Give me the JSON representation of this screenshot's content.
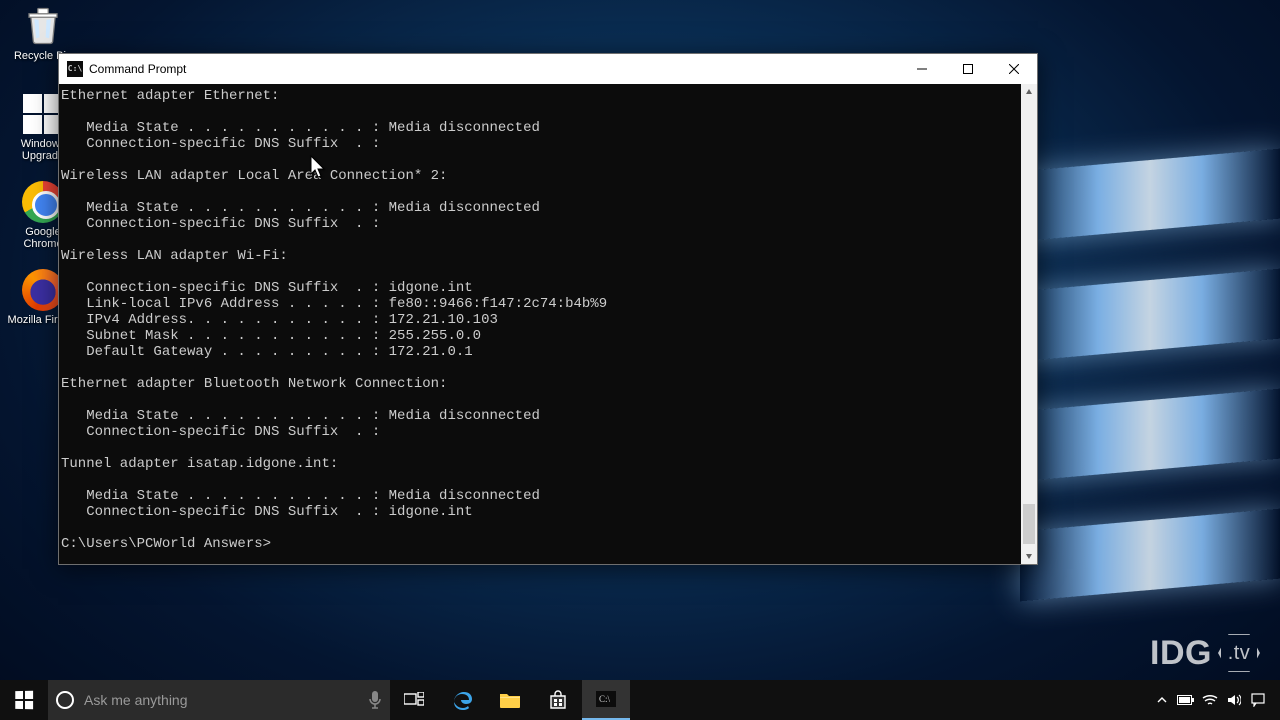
{
  "desktop_icons": {
    "recycle_bin": "Recycle Bin",
    "windows_upgrade": "Windows Upgrade",
    "google_chrome": "Google Chrome",
    "mozilla_firefox": "Mozilla Firefox"
  },
  "window": {
    "title": "Command Prompt"
  },
  "terminal": {
    "lines": [
      "Ethernet adapter Ethernet:",
      "",
      "   Media State . . . . . . . . . . . : Media disconnected",
      "   Connection-specific DNS Suffix  . :",
      "",
      "Wireless LAN adapter Local Area Connection* 2:",
      "",
      "   Media State . . . . . . . . . . . : Media disconnected",
      "   Connection-specific DNS Suffix  . :",
      "",
      "Wireless LAN adapter Wi-Fi:",
      "",
      "   Connection-specific DNS Suffix  . : idgone.int",
      "   Link-local IPv6 Address . . . . . : fe80::9466:f147:2c74:b4b%9",
      "   IPv4 Address. . . . . . . . . . . : 172.21.10.103",
      "   Subnet Mask . . . . . . . . . . . : 255.255.0.0",
      "   Default Gateway . . . . . . . . . : 172.21.0.1",
      "",
      "Ethernet adapter Bluetooth Network Connection:",
      "",
      "   Media State . . . . . . . . . . . : Media disconnected",
      "   Connection-specific DNS Suffix  . :",
      "",
      "Tunnel adapter isatap.idgone.int:",
      "",
      "   Media State . . . . . . . . . . . : Media disconnected",
      "   Connection-specific DNS Suffix  . : idgone.int",
      "",
      "C:\\Users\\PCWorld Answers>"
    ]
  },
  "taskbar": {
    "search_placeholder": "Ask me anything"
  },
  "watermark": {
    "brand": "IDG",
    "suffix": ".tv"
  }
}
